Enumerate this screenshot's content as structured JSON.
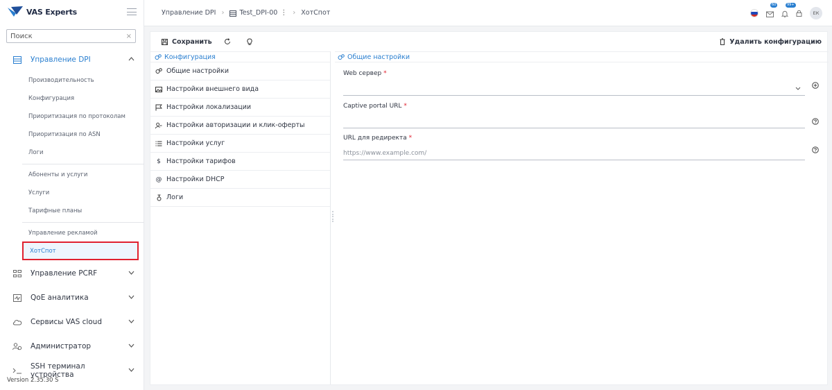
{
  "brand": {
    "name": "VAS Experts",
    "accent": "#2a7fd0",
    "highlight": "#e0202e"
  },
  "sidebar": {
    "search_placeholder": "Поиск",
    "groups": [
      {
        "label": "Управление DPI",
        "icon": "server-icon",
        "expanded": true
      },
      {
        "label": "Управление PCRF",
        "icon": "pcrf-icon"
      },
      {
        "label": "QoE аналитика",
        "icon": "chart-icon"
      },
      {
        "label": "Сервисы VAS cloud",
        "icon": "cloud-icon"
      },
      {
        "label": "Администратор",
        "icon": "users-icon"
      },
      {
        "label": "SSH терминал устройства",
        "icon": "terminal-icon"
      }
    ],
    "dpi_items": [
      "Производительность",
      "Конфигурация",
      "Приоритизация по протоколам",
      "Приоритизация по ASN",
      "Логи",
      "Абоненты и услуги",
      "Услуги",
      "Тарифные планы",
      "Управление рекламой",
      "ХотСпот"
    ],
    "version": "Version 2.35.30 S"
  },
  "topbar": {
    "breadcrumb": [
      "Управление DPI",
      "Test_DPI-00",
      "ХотСпот"
    ],
    "mail_badge": "60",
    "notif_badge": "99+",
    "avatar": "ЕК"
  },
  "toolbar": {
    "save_label": "Сохранить",
    "delete_label": "Удалить конфигурацию"
  },
  "config_menu": {
    "header": "Конфигурация",
    "items": [
      {
        "label": "Общие настройки",
        "icon": "gears-icon"
      },
      {
        "label": "Настройки внешнего вида",
        "icon": "image-icon"
      },
      {
        "label": "Настройки локализации",
        "icon": "flag-icon"
      },
      {
        "label": "Настройки авторизации и клик-оферты",
        "icon": "user-key-icon"
      },
      {
        "label": "Настройки услуг",
        "icon": "list-icon"
      },
      {
        "label": "Настройки тарифов",
        "icon": "dollar-icon"
      },
      {
        "label": "Настройки DHCP",
        "icon": "at-icon"
      },
      {
        "label": "Логи",
        "icon": "logs-icon"
      }
    ]
  },
  "general": {
    "header": "Общие настройки",
    "fields": [
      {
        "label": "Web сервер",
        "value": "",
        "placeholder": ""
      },
      {
        "label": "Captive portal URL",
        "value": "",
        "placeholder": ""
      },
      {
        "label": "URL для редиректа",
        "value": "",
        "placeholder": "https://www.example.com/"
      }
    ]
  }
}
